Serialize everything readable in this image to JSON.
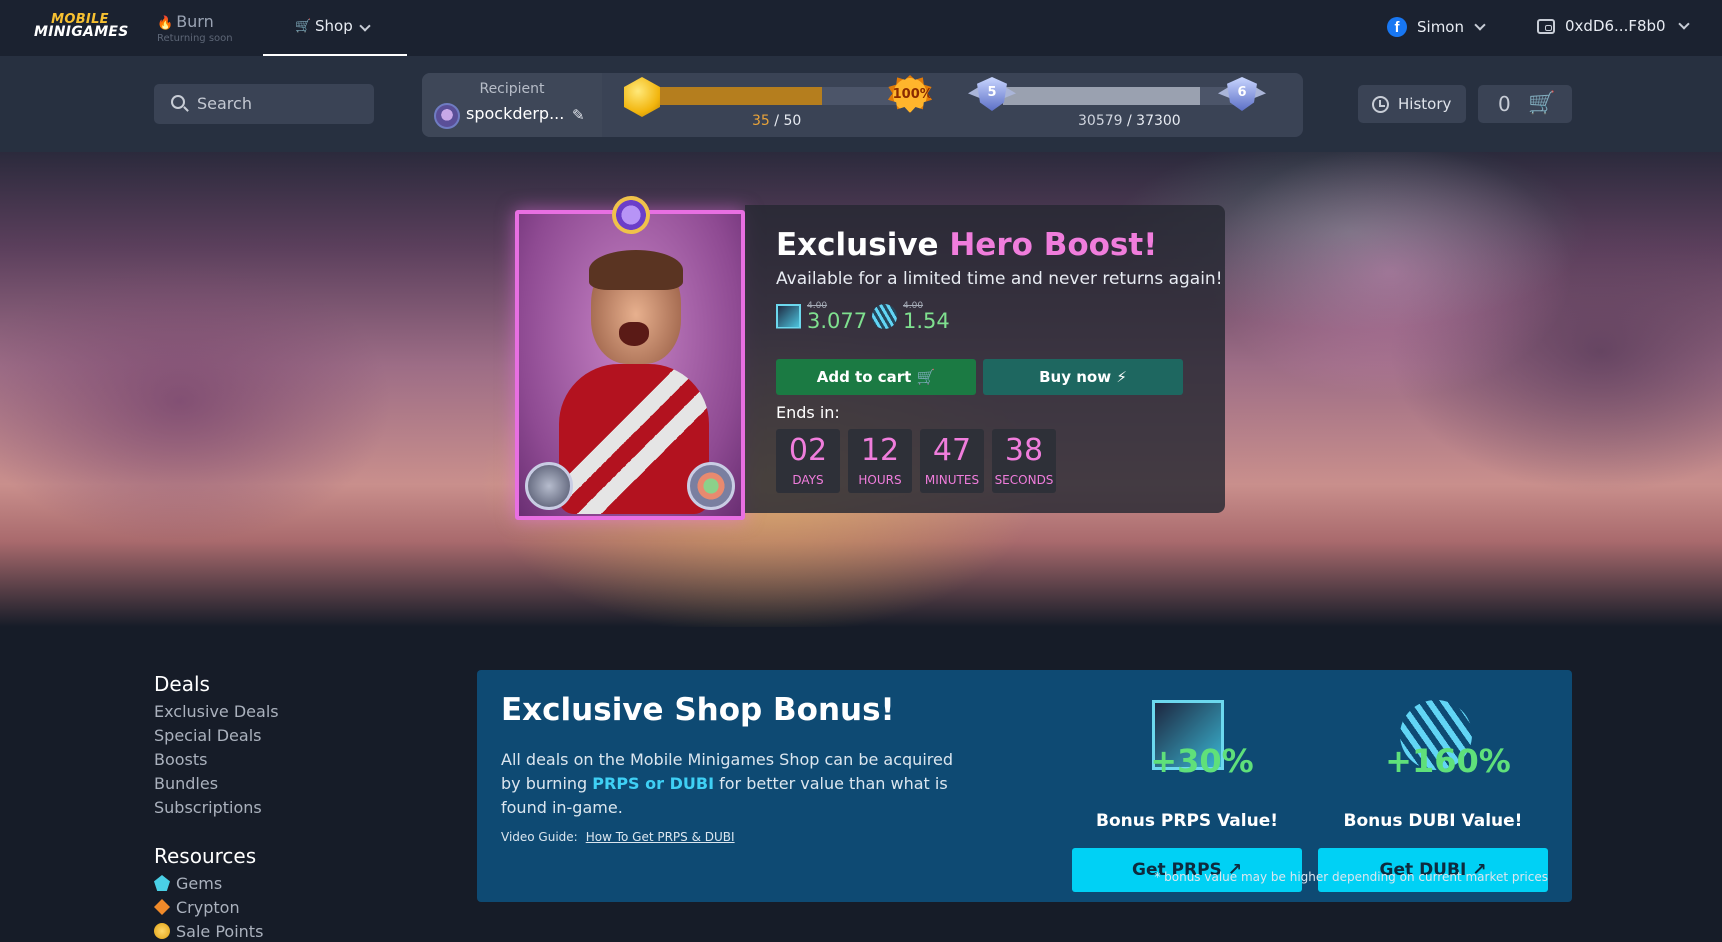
{
  "nav": {
    "logo_line1": "MOBILE",
    "logo_line2": "MINIGAMES",
    "burn_label": "Burn",
    "burn_sub": "Returning soon",
    "shop_label": "Shop",
    "user_name": "Simon",
    "wallet_address": "0xdD6...F8b0"
  },
  "subbar": {
    "search_placeholder": "Search",
    "recipient_label": "Recipient",
    "recipient_name": "spockderp...",
    "level_current": "35",
    "level_total": " / 50",
    "level_badge": "-100%",
    "level_progress": 0.7,
    "rank_from": "5",
    "rank_to": "6",
    "rank_current": "30579",
    "rank_total": " / 37300",
    "rank_progress": 0.82,
    "history_label": "History",
    "cart_count": "0"
  },
  "hero": {
    "title_part1": "Exclusive ",
    "title_part2": "Hero Boost!",
    "subtitle": "Available for a limited time and never returns again!",
    "prps_old": "4.00",
    "prps_new": "3.077",
    "dubi_old": "4.00",
    "dubi_new": "1.54",
    "add_to_cart": "Add to cart",
    "buy_now": "Buy now",
    "ends_in": "Ends in:",
    "countdown": [
      {
        "value": "02",
        "unit": "DAYS"
      },
      {
        "value": "12",
        "unit": "HOURS"
      },
      {
        "value": "47",
        "unit": "MINUTES"
      },
      {
        "value": "38",
        "unit": "SECONDS"
      }
    ]
  },
  "sidebar": {
    "deals_title": "Deals",
    "deals": [
      "Exclusive Deals",
      "Special Deals",
      "Boosts",
      "Bundles",
      "Subscriptions"
    ],
    "resources_title": "Resources",
    "resources": [
      "Gems",
      "Crypton",
      "Sale Points"
    ]
  },
  "bonus": {
    "title": "Exclusive Shop Bonus!",
    "text_before": "All deals on the Mobile Minigames Shop can be acquired by burning ",
    "text_highlight": "PRPS or DUBI",
    "text_after": " for better value than what is found in-game.",
    "video_label": "Video Guide:",
    "video_link": "How To Get PRPS & DUBI",
    "prps_pct": "+30%",
    "prps_label": "Bonus PRPS Value!",
    "prps_button": "Get PRPS",
    "dubi_pct": "+160%",
    "dubi_label": "Bonus DUBI Value!",
    "dubi_button": "Get DUBI",
    "note": "* bonus value may be higher depending on current market prices"
  },
  "colors": {
    "accent_pink": "#f07ddc",
    "price_green": "#7fe08f",
    "cyan_button": "#00d1f5",
    "bonus_bg": "#0e4a73"
  }
}
